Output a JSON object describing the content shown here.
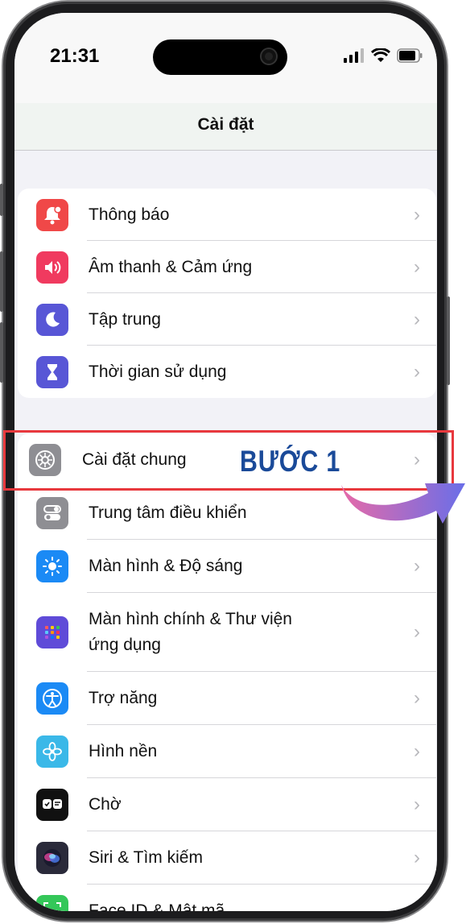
{
  "status": {
    "time": "21:31"
  },
  "header": {
    "title": "Cài đặt"
  },
  "group1": [
    {
      "label": "Thông báo",
      "icon": "bell-icon",
      "color": "#f04848"
    },
    {
      "label": "Âm thanh & Cảm ứng",
      "icon": "speaker-icon",
      "color": "#f03a5f"
    },
    {
      "label": "Tập trung",
      "icon": "moon-icon",
      "color": "#5856d6"
    },
    {
      "label": "Thời gian sử dụng",
      "icon": "hourglass-icon",
      "color": "#5856d6"
    }
  ],
  "group2": [
    {
      "label": "Cài đặt chung",
      "icon": "gear-icon",
      "color": "#8e8e93"
    },
    {
      "label": "Trung tâm điều khiển",
      "icon": "toggle-icon",
      "color": "#8e8e93"
    },
    {
      "label": "Màn hình & Độ sáng",
      "icon": "sun-icon",
      "color": "#1b8af5"
    },
    {
      "label": "Màn hình chính & Thư viện\nứng dụng",
      "icon": "grid-icon",
      "color": "#5f4bd8"
    },
    {
      "label": "Trợ năng",
      "icon": "accessibility-icon",
      "color": "#1b8af5"
    },
    {
      "label": "Hình nền",
      "icon": "flower-icon",
      "color": "#3ab8e8"
    },
    {
      "label": "Chờ",
      "icon": "standby-icon",
      "color": "#111111"
    },
    {
      "label": "Siri & Tìm kiếm",
      "icon": "siri-icon",
      "color": "#2a2a3a"
    },
    {
      "label": "Face ID & Mật mã",
      "icon": "faceid-icon",
      "color": "#34c759"
    }
  ],
  "annotation": {
    "step_label": "BƯỚC 1",
    "highlight_color": "#e8383d"
  }
}
